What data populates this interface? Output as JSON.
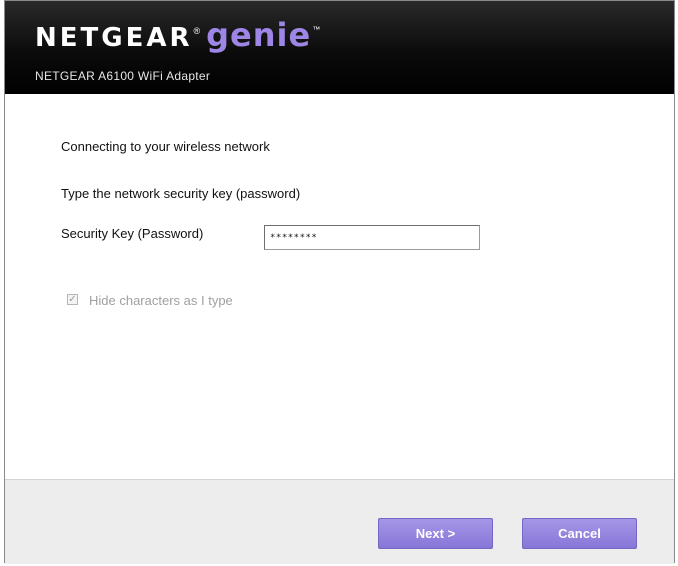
{
  "header": {
    "brand_netgear": "NETGEAR",
    "brand_reg": "®",
    "brand_genie": "genie",
    "brand_tm": "™",
    "subtitle": "NETGEAR A6100 WiFi Adapter"
  },
  "main": {
    "heading": "Connecting to your wireless network",
    "instruction": "Type the network security key (password)",
    "key_label": "Security Key (Password)",
    "key_value": "********",
    "hide_label": "Hide characters as I type",
    "hide_checked": true
  },
  "footer": {
    "next_label": "Next >",
    "cancel_label": "Cancel"
  },
  "colors": {
    "header_bg": "#000000",
    "genie_accent": "#9d86e6",
    "button_bg": "#8f7fdc"
  }
}
